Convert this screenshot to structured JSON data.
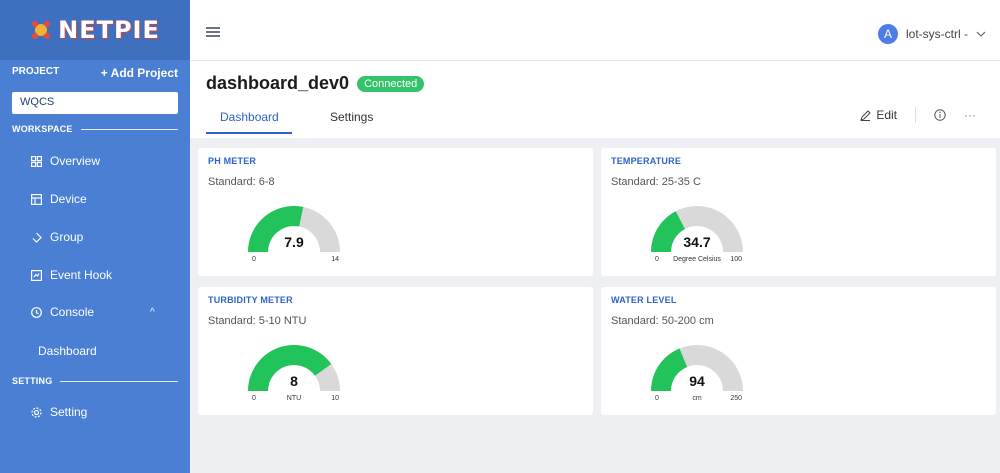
{
  "logo": {
    "text": "NETPIE"
  },
  "sidebar": {
    "project_label": "PROJECT",
    "add_project": "+ Add Project",
    "project_value": "WQCS",
    "workspace_label": "WORKSPACE",
    "setting_label": "SETTING",
    "items": [
      {
        "label": "Overview"
      },
      {
        "label": "Device"
      },
      {
        "label": "Group"
      },
      {
        "label": "Event Hook"
      },
      {
        "label": "Console"
      },
      {
        "label": "Dashboard"
      },
      {
        "label": "Setting"
      }
    ]
  },
  "topbar": {
    "user_initial": "A",
    "user_name": "lot-sys-ctrl -"
  },
  "header": {
    "title": "dashboard_dev0",
    "status": "Connected",
    "tabs": [
      {
        "label": "Dashboard"
      },
      {
        "label": "Settings"
      }
    ],
    "edit_label": "Edit",
    "more_label": "···"
  },
  "colors": {
    "accent": "#2f63c7",
    "sidebar": "#4a7fd4",
    "gauge_fill": "#22c35a",
    "gauge_track": "#d9d9d9",
    "connected": "#34c26b"
  },
  "cards": [
    {
      "title": "PH METER",
      "standard": "Standard: 6-8",
      "value": "7.9",
      "min": "0",
      "max": "14",
      "unit": "",
      "fraction": 0.564
    },
    {
      "title": "TEMPERATURE",
      "standard": "Standard: 25-35 C",
      "value": "34.7",
      "min": "0",
      "max": "100",
      "unit": "Degree Celsius",
      "fraction": 0.347
    },
    {
      "title": "TURBIDITY METER",
      "standard": "Standard: 5-10 NTU",
      "value": "8",
      "min": "0",
      "max": "10",
      "unit": "NTU",
      "fraction": 0.8
    },
    {
      "title": "WATER LEVEL",
      "standard": "Standard: 50-200 cm",
      "value": "94",
      "min": "0",
      "max": "250",
      "unit": "cm",
      "fraction": 0.376
    }
  ]
}
